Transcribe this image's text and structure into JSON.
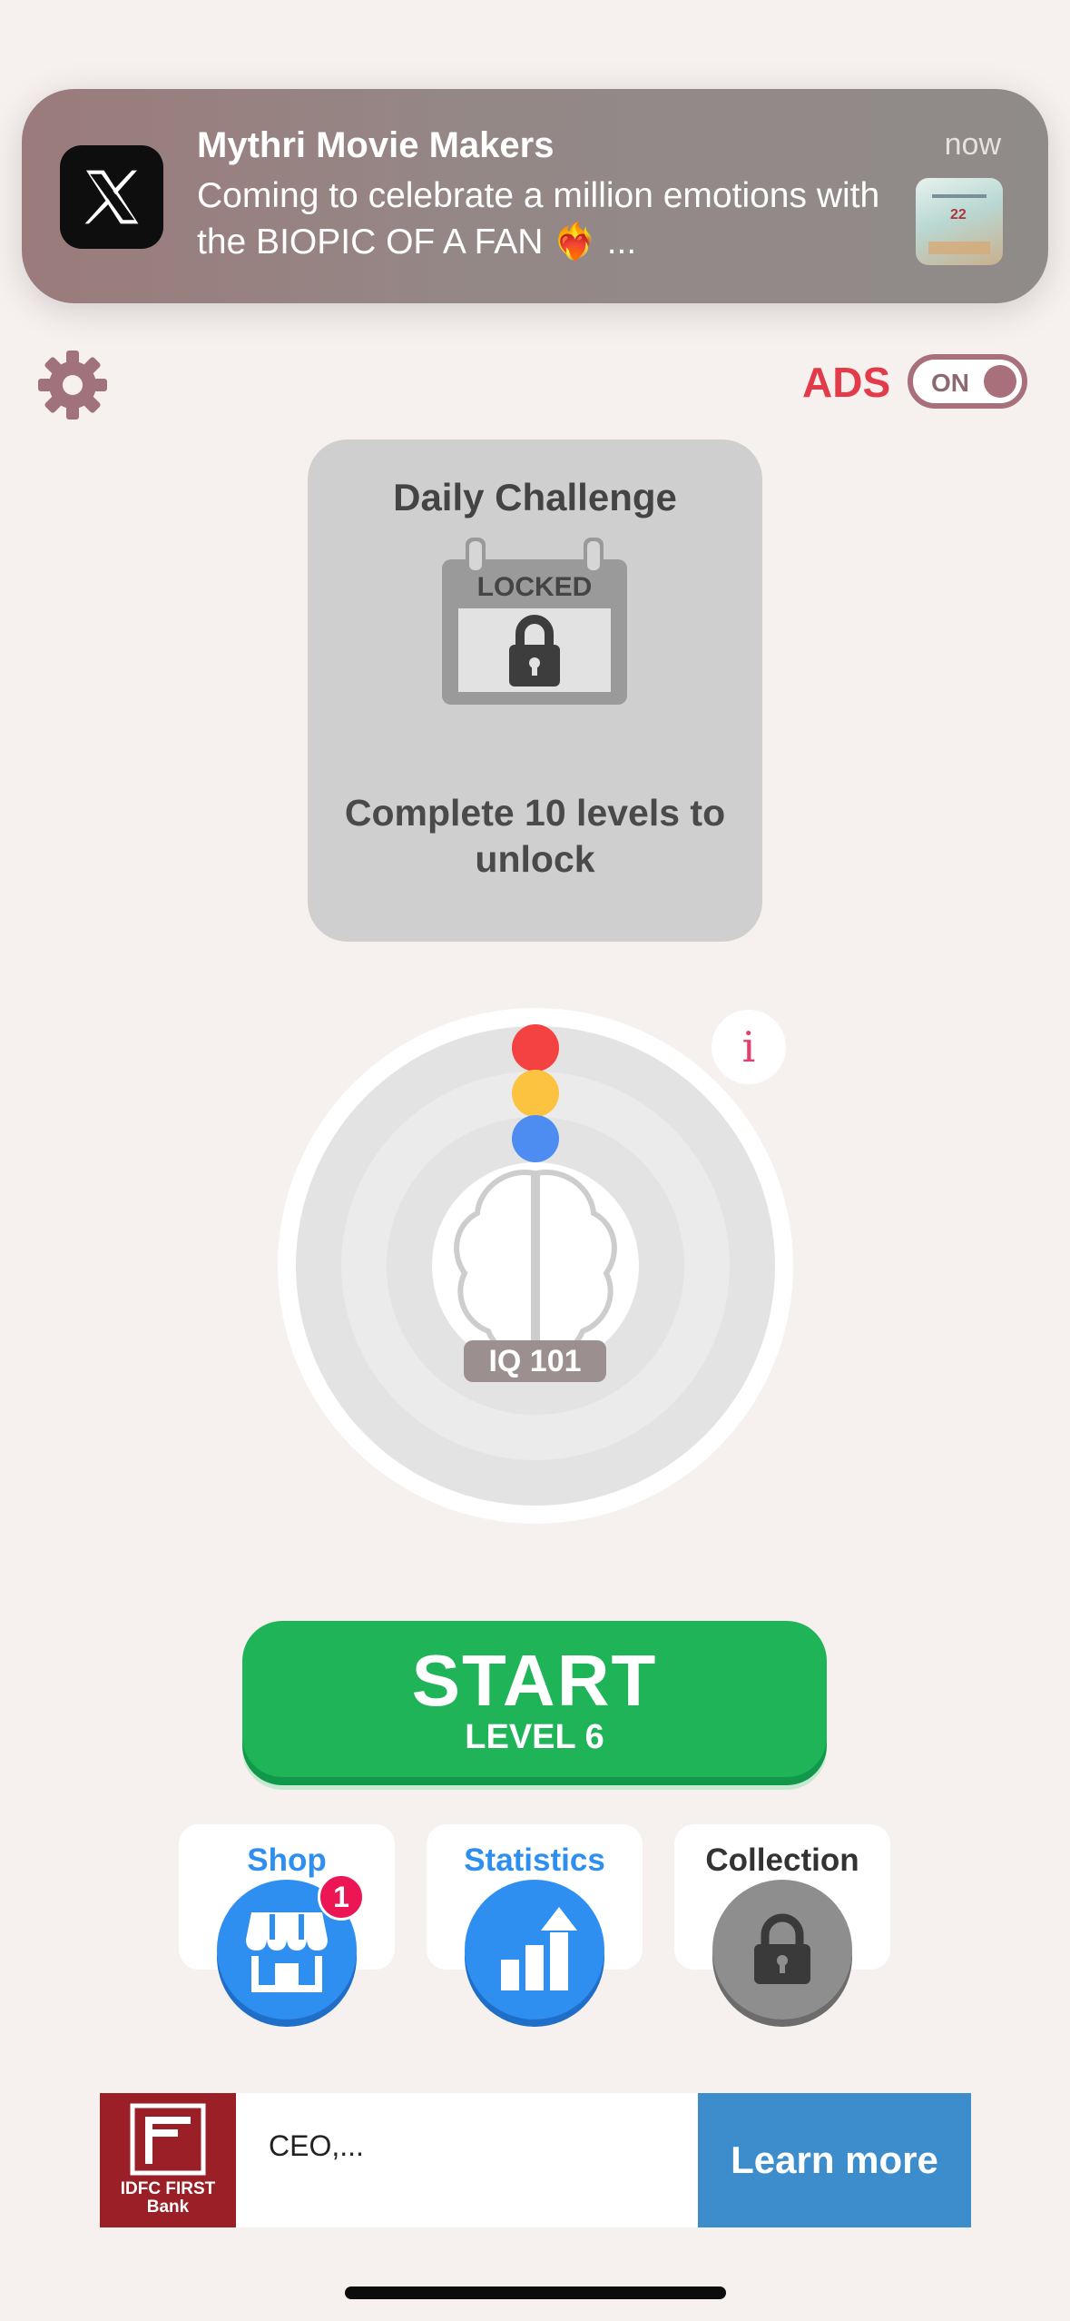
{
  "notification": {
    "title": "Mythri Movie Makers",
    "time": "now",
    "body": "Coming to celebrate a million emotions with the BIOPIC OF A FAN ❤️‍🔥 ...",
    "app_icon": "x-logo-icon",
    "thumbnail_number": "22"
  },
  "header": {
    "settings_icon": "gear-icon",
    "ads_label": "ADS",
    "ads_toggle_state": "ON"
  },
  "daily_challenge": {
    "title": "Daily Challenge",
    "locked_label": "LOCKED",
    "description": "Complete 10 levels to unlock"
  },
  "iq_meter": {
    "info_label": "i",
    "iq_label": "IQ 101",
    "dot_colors": [
      "#f44242",
      "#fbc33f",
      "#4d8df2"
    ]
  },
  "start_button": {
    "title": "START",
    "subtitle": "LEVEL 6"
  },
  "bottom_menu": {
    "shop": {
      "label": "Shop",
      "badge": "1",
      "color": "#2f8ff0"
    },
    "statistics": {
      "label": "Statistics",
      "color": "#2f8ff0"
    },
    "collection": {
      "label": "Collection",
      "color": "#333333"
    }
  },
  "ad_banner": {
    "logo_text_line1": "IDFC FIRST",
    "logo_text_line2": "Bank",
    "text": "CEO,...",
    "cta": "Learn more"
  },
  "colors": {
    "background": "#f6f0ef",
    "accent_green": "#1fb458",
    "accent_red": "#e23b4a",
    "accent_blue": "#2f8ff0"
  }
}
